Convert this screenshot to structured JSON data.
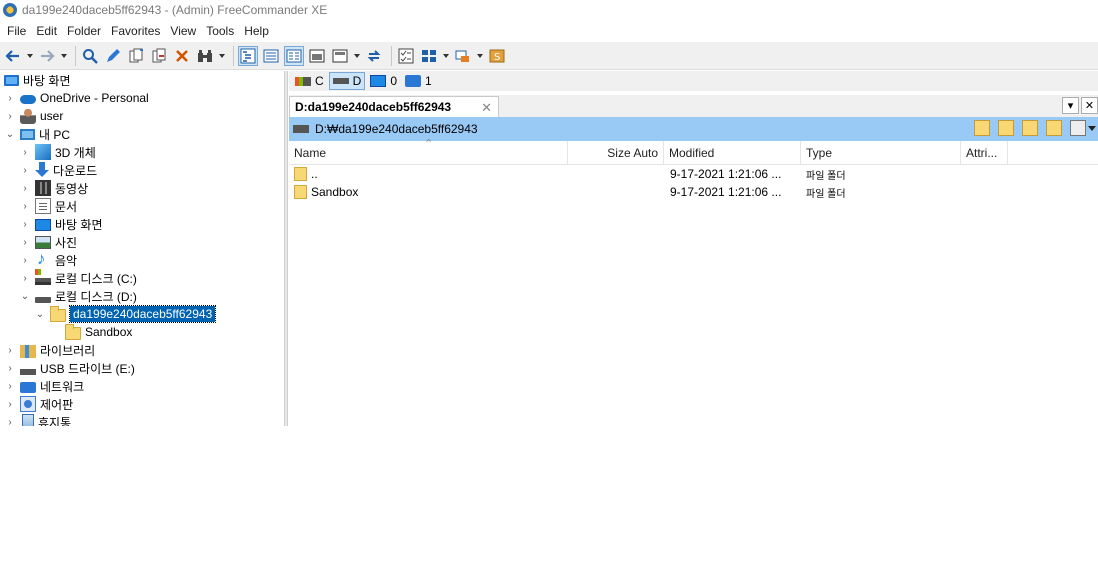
{
  "window": {
    "title": "da199e240daceb5ff62943 - (Admin) FreeCommander XE"
  },
  "menu": [
    "File",
    "Edit",
    "Folder",
    "Favorites",
    "View",
    "Tools",
    "Help"
  ],
  "tree": {
    "items": [
      {
        "label": "바탕 화면",
        "icon": "desktop-icon",
        "level": 0
      },
      {
        "label": "OneDrive - Personal",
        "icon": "cloud-icon",
        "level": 1
      },
      {
        "label": "user",
        "icon": "user-icon",
        "level": 1
      },
      {
        "label": "내 PC",
        "icon": "pc-icon",
        "level": 1
      },
      {
        "label": "3D 개체",
        "icon": "cube-icon",
        "level": 2
      },
      {
        "label": "다운로드",
        "icon": "download-icon",
        "level": 2
      },
      {
        "label": "동영상",
        "icon": "video-icon",
        "level": 2
      },
      {
        "label": "문서",
        "icon": "document-icon",
        "level": 2
      },
      {
        "label": "바탕 화면",
        "icon": "desktop-icon",
        "level": 2
      },
      {
        "label": "사진",
        "icon": "picture-icon",
        "level": 2
      },
      {
        "label": "음악",
        "icon": "music-icon",
        "level": 2
      },
      {
        "label": "로컬 디스크 (C:)",
        "icon": "drive-c-icon",
        "level": 2
      },
      {
        "label": "로컬 디스크 (D:)",
        "icon": "drive-icon",
        "level": 2
      },
      {
        "label": "da199e240daceb5ff62943",
        "icon": "folder-icon",
        "level": 3,
        "selected": true
      },
      {
        "label": "Sandbox",
        "icon": "folder-icon",
        "level": 4
      },
      {
        "label": "라이브러리",
        "icon": "library-icon",
        "level": 1
      },
      {
        "label": "USB 드라이브 (E:)",
        "icon": "usb-drive-icon",
        "level": 1
      },
      {
        "label": "네트워크",
        "icon": "network-icon",
        "level": 1
      },
      {
        "label": "제어판",
        "icon": "control-panel-icon",
        "level": 1
      },
      {
        "label": "휴지통",
        "icon": "recycle-bin-icon",
        "level": 1
      }
    ]
  },
  "drives": [
    {
      "label": "C",
      "icon": "drive-c-icon"
    },
    {
      "label": "D",
      "icon": "drive-d-icon",
      "active": true
    },
    {
      "label": "0",
      "icon": "desktop-icon"
    },
    {
      "label": "1",
      "icon": "network-icon"
    }
  ],
  "tab": {
    "label": "D:da199e240daceb5ff62943",
    "close": "✕"
  },
  "path": {
    "text": "D:₩da199e240daceb5ff62943"
  },
  "columns": {
    "name": "Name",
    "size": "Size Auto",
    "modified": "Modified",
    "type": "Type",
    "attr": "Attri..."
  },
  "files": [
    {
      "name": "..",
      "size": "",
      "modified": "9-17-2021 1:21:06 ...",
      "type": "파일 폴더"
    },
    {
      "name": "Sandbox",
      "size": "",
      "modified": "9-17-2021 1:21:06 ...",
      "type": "파일 폴더"
    }
  ],
  "colors": {
    "selection": "#0063b1",
    "path_bar": "#99c9f5",
    "folder": "#f8d775"
  }
}
